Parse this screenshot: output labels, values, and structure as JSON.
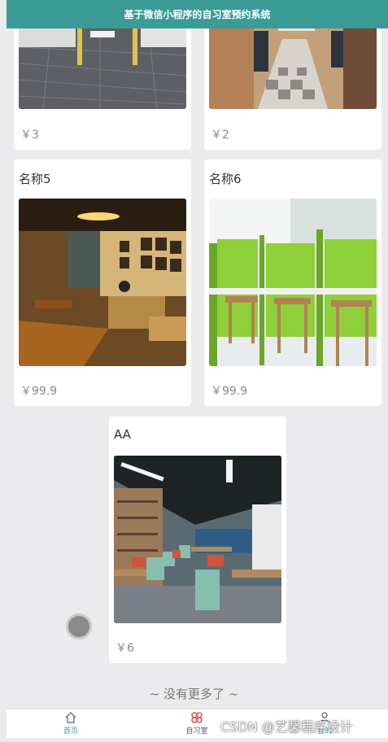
{
  "title": "基于微信小程序的自习室预约系统",
  "rooms": [
    {
      "name": "",
      "price": "￥3"
    },
    {
      "name": "",
      "price": "￥2"
    },
    {
      "name": "名称5",
      "price": "￥99.9"
    },
    {
      "name": "名称6",
      "price": "￥99.9"
    },
    {
      "name": "AA",
      "price": "￥6"
    }
  ],
  "no_more_text": "~ 没有更多了 ~",
  "tabs": [
    {
      "label": "首页",
      "icon": "home-icon"
    },
    {
      "label": "自习室",
      "icon": "clover-icon"
    },
    {
      "label": "我的",
      "icon": "user-icon"
    }
  ],
  "watermark": "CSDN @艺馨程序设计",
  "colors": {
    "header": "#3a9b97",
    "tab_active": "#3a9b97",
    "clover": "#e8534a"
  }
}
